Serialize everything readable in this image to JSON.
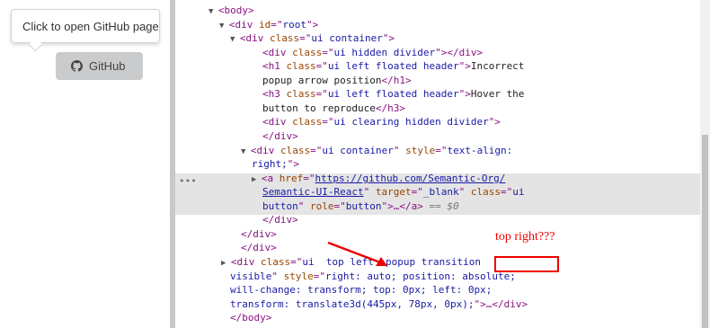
{
  "left_page": {
    "popup_text": "Click to open GitHub page",
    "button_label": "GitHub",
    "button_icon": "github-icon"
  },
  "devtools": {
    "lines": [
      {
        "id": "l0",
        "parts": [
          [
            "tri",
            "▼"
          ],
          [
            "tag",
            "<body>"
          ]
        ]
      },
      {
        "id": "l1",
        "parts": [
          [
            "tri",
            "▼"
          ],
          [
            "tag",
            "<div "
          ],
          [
            "attr",
            "id"
          ],
          [
            "tag",
            "=\""
          ],
          [
            "val",
            "root"
          ],
          [
            "tag",
            "\">"
          ]
        ]
      },
      {
        "id": "l2",
        "parts": [
          [
            "tri",
            "▼"
          ],
          [
            "tag",
            "<div "
          ],
          [
            "attr",
            "class"
          ],
          [
            "tag",
            "=\""
          ],
          [
            "val",
            "ui container"
          ],
          [
            "tag",
            "\">"
          ]
        ]
      },
      {
        "id": "l3",
        "parts": [
          [
            "tag",
            "<div "
          ],
          [
            "attr",
            "class"
          ],
          [
            "tag",
            "=\""
          ],
          [
            "val",
            "ui hidden divider"
          ],
          [
            "tag",
            "\"></div>"
          ]
        ]
      },
      {
        "id": "l4",
        "parts": [
          [
            "tag",
            "<h1 "
          ],
          [
            "attr",
            "class"
          ],
          [
            "tag",
            "=\""
          ],
          [
            "val",
            "ui left floated header"
          ],
          [
            "tag",
            "\">"
          ],
          [
            "txt",
            "Incorrect"
          ]
        ]
      },
      {
        "id": "l5",
        "parts": [
          [
            "txt",
            "popup arrow position"
          ],
          [
            "tag",
            "</h1>"
          ]
        ]
      },
      {
        "id": "l6",
        "parts": [
          [
            "tag",
            "<h3 "
          ],
          [
            "attr",
            "class"
          ],
          [
            "tag",
            "=\""
          ],
          [
            "val",
            "ui left floated header"
          ],
          [
            "tag",
            "\">"
          ],
          [
            "txt",
            "Hover the"
          ]
        ]
      },
      {
        "id": "l7",
        "parts": [
          [
            "txt",
            "button to reproduce"
          ],
          [
            "tag",
            "</h3>"
          ]
        ]
      },
      {
        "id": "l8",
        "parts": [
          [
            "tag",
            "<div "
          ],
          [
            "attr",
            "class"
          ],
          [
            "tag",
            "=\""
          ],
          [
            "val",
            "ui clearing hidden divider"
          ],
          [
            "tag",
            "\">"
          ]
        ]
      },
      {
        "id": "l9",
        "parts": [
          [
            "tag",
            "</div>"
          ]
        ]
      },
      {
        "id": "l10",
        "parts": [
          [
            "tri",
            "▼"
          ],
          [
            "tag",
            "<div "
          ],
          [
            "attr",
            "class"
          ],
          [
            "tag",
            "=\""
          ],
          [
            "val",
            "ui container"
          ],
          [
            "tag",
            "\" "
          ],
          [
            "attr",
            "style"
          ],
          [
            "tag",
            "=\""
          ],
          [
            "val",
            "text-align:"
          ]
        ]
      },
      {
        "id": "l11",
        "parts": [
          [
            "val",
            "right;"
          ],
          [
            "tag",
            "\">"
          ]
        ]
      },
      {
        "id": "l12",
        "parts": [
          [
            "tri",
            "▶"
          ],
          [
            "tag",
            "<a "
          ],
          [
            "attr",
            "href"
          ],
          [
            "tag",
            "=\""
          ],
          [
            "link",
            "https://github.com/Semantic-Org/"
          ]
        ]
      },
      {
        "id": "l13",
        "parts": [
          [
            "link",
            "Semantic-UI-React"
          ],
          [
            "tag",
            "\" "
          ],
          [
            "attr",
            "target"
          ],
          [
            "tag",
            "=\""
          ],
          [
            "val",
            "_blank"
          ],
          [
            "tag",
            "\" "
          ],
          [
            "attr",
            "class"
          ],
          [
            "tag",
            "=\""
          ],
          [
            "val",
            "ui"
          ]
        ]
      },
      {
        "id": "l14",
        "parts": [
          [
            "val",
            "button"
          ],
          [
            "tag",
            "\" "
          ],
          [
            "attr",
            "role"
          ],
          [
            "tag",
            "=\""
          ],
          [
            "val",
            "button"
          ],
          [
            "tag",
            "\">…</a>"
          ],
          [
            "muted",
            " == $0"
          ]
        ]
      },
      {
        "id": "l15",
        "parts": [
          [
            "tag",
            "</div>"
          ]
        ]
      },
      {
        "id": "l16",
        "parts": [
          [
            "tag",
            "</div>"
          ]
        ]
      },
      {
        "id": "l17",
        "parts": [
          [
            "tag",
            "</div>"
          ]
        ]
      },
      {
        "id": "l18",
        "parts": [
          [
            "tri",
            "▶"
          ],
          [
            "tag",
            "<div "
          ],
          [
            "attr",
            "class"
          ],
          [
            "tag",
            "=\""
          ],
          [
            "val",
            "ui  top left  popup transition"
          ]
        ]
      },
      {
        "id": "l19",
        "parts": [
          [
            "val",
            "visible"
          ],
          [
            "tag",
            "\" "
          ],
          [
            "attr",
            "style"
          ],
          [
            "tag",
            "=\""
          ],
          [
            "val",
            "right: auto; position: absolute;"
          ]
        ]
      },
      {
        "id": "l20",
        "parts": [
          [
            "val",
            "will-change: transform; top: 0px; left: 0px;"
          ]
        ]
      },
      {
        "id": "l21",
        "parts": [
          [
            "val",
            "transform: translate3d(445px, 78px, 0px);"
          ],
          [
            "tag",
            "\">…</div>"
          ]
        ]
      },
      {
        "id": "l22",
        "parts": [
          [
            "tag",
            "</body>"
          ]
        ]
      }
    ],
    "row_menu": "•••"
  },
  "annotation": {
    "text": "top right???",
    "color": "#e00000"
  }
}
